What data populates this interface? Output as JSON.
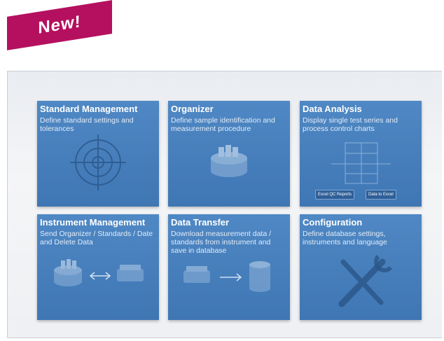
{
  "banner": {
    "label": "New!"
  },
  "tiles": [
    {
      "title": "Standard Management",
      "description": "Define standard settings and tolerances",
      "icon": "target-icon"
    },
    {
      "title": "Organizer",
      "description": "Define sample identification and measurement procedure",
      "icon": "sample-tray-icon"
    },
    {
      "title": "Data Analysis",
      "description": "Display single test series and process control charts",
      "icon": "control-chart-icon",
      "buttons": [
        "Excel QC Reports",
        "Data to Excel"
      ]
    },
    {
      "title": "Instrument Management",
      "description": "Send Organizer / Standards / Date and Delete Data",
      "icon": "sync-transfer-icon"
    },
    {
      "title": "Data Transfer",
      "description": "Download measurement data / standards from instrument and save in database",
      "icon": "database-download-icon"
    },
    {
      "title": "Configuration",
      "description": "Define database settings, instruments and language",
      "icon": "tools-icon"
    }
  ],
  "colors": {
    "banner": "#b5105f",
    "tile": "#4a83c0",
    "background": "#eef0f3"
  }
}
